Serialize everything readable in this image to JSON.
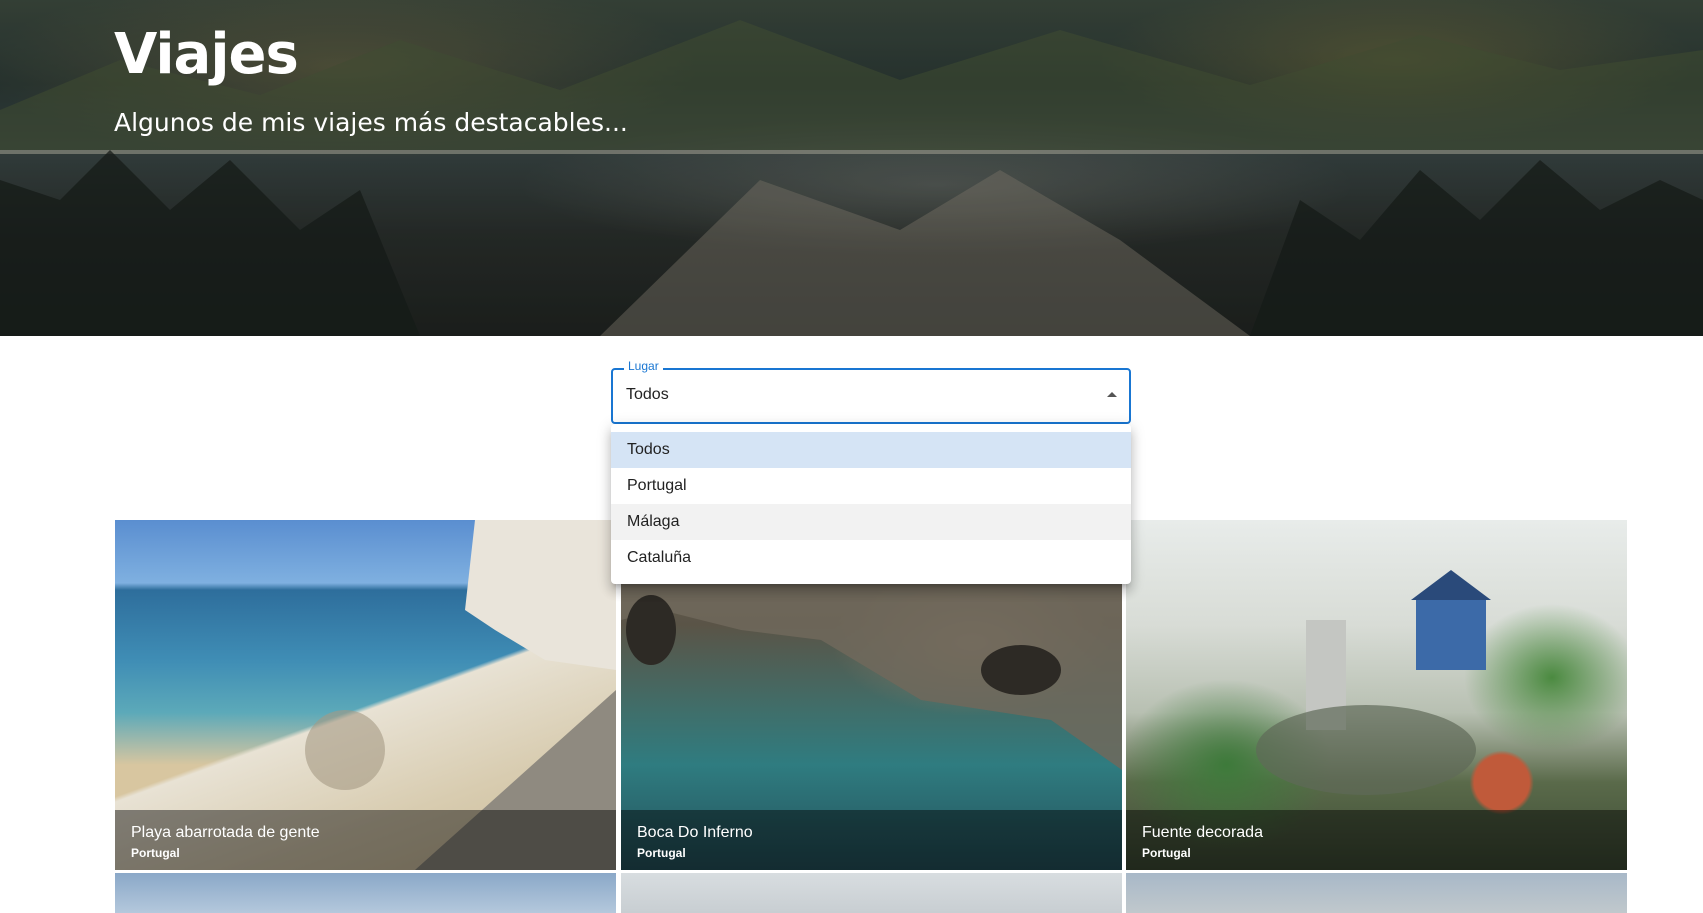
{
  "hero": {
    "title": "Viajes",
    "subtitle": "Algunos de mis viajes más destacables..."
  },
  "filter": {
    "label": "Lugar",
    "value": "Todos",
    "options": [
      "Todos",
      "Portugal",
      "Málaga",
      "Cataluña"
    ]
  },
  "cards": [
    {
      "title": "Playa abarrotada de gente",
      "subtitle": "Portugal"
    },
    {
      "title": "Boca Do Inferno",
      "subtitle": "Portugal"
    },
    {
      "title": "Fuente decorada",
      "subtitle": "Portugal"
    }
  ],
  "colors": {
    "accent": "#1976d2",
    "selected_option_bg": "#d5e4f5",
    "hover_option_bg": "#f2f2f2"
  }
}
